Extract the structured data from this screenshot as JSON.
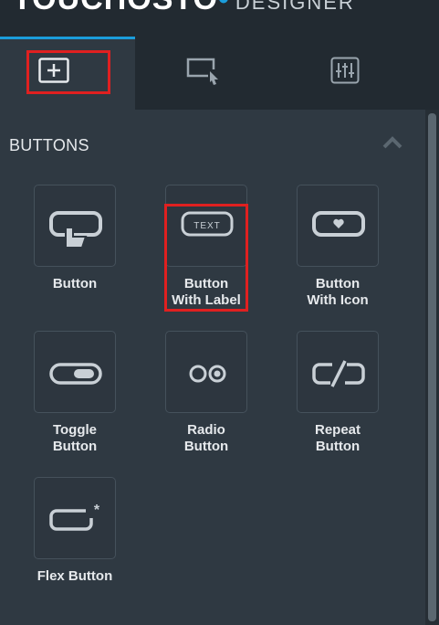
{
  "app": {
    "brand_main": "TOUCHOSTO",
    "brand_sub": "DESIGNER"
  },
  "tabs": [
    {
      "name": "add-controls",
      "icon": "add-box-icon",
      "active": true
    },
    {
      "name": "select-element",
      "icon": "select-cursor-icon",
      "active": false
    },
    {
      "name": "properties",
      "icon": "sliders-icon",
      "active": false
    }
  ],
  "panel": {
    "title": "BUTTONS",
    "collapse_icon": "chevron-up-icon"
  },
  "controls": [
    {
      "line1": "Button",
      "line2": "",
      "icon": "tap-button-icon"
    },
    {
      "line1": "Button",
      "line2": "With Label",
      "icon": "text-button-icon"
    },
    {
      "line1": "Button",
      "line2": "With Icon",
      "icon": "heart-button-icon"
    },
    {
      "line1": "Toggle",
      "line2": "Button",
      "icon": "toggle-icon"
    },
    {
      "line1": "Radio",
      "line2": "Button",
      "icon": "radio-icon"
    },
    {
      "line1": "Repeat",
      "line2": "Button",
      "icon": "repeat-slash-icon"
    },
    {
      "line1": "Flex Button",
      "line2": "",
      "icon": "flex-button-icon"
    }
  ],
  "text_badge": "TEXT",
  "colors": {
    "accent": "#1b9ddb",
    "highlight": "#e02020",
    "panel": "#2f3942",
    "header": "#222a31"
  }
}
